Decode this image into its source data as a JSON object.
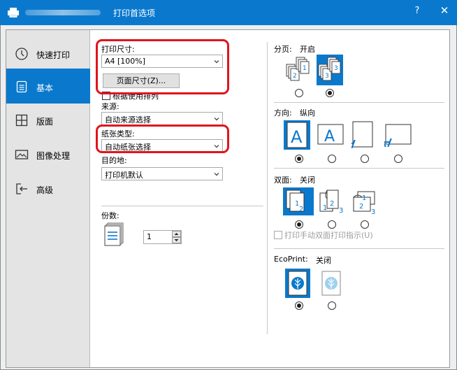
{
  "window": {
    "title": "打印首选项",
    "help_label": "?",
    "close_label": "✕"
  },
  "sidebar": {
    "items": [
      {
        "label": "快速打印",
        "icon": "clock-icon",
        "active": false
      },
      {
        "label": "基本",
        "icon": "document-icon",
        "active": true
      },
      {
        "label": "版面",
        "icon": "layout-grid-icon",
        "active": false
      },
      {
        "label": "图像处理",
        "icon": "image-icon",
        "active": false
      },
      {
        "label": "高级",
        "icon": "advanced-arrow-icon",
        "active": false
      }
    ]
  },
  "basic": {
    "print_size_label": "打印尺寸:",
    "print_size_value": "A4  [100%]",
    "page_size_button": "页面尺寸(Z)...",
    "fit_by_usage_label": "根据使用排列",
    "source_label": "来源:",
    "source_value": "自动来源选择",
    "media_type_label": "纸张类型:",
    "media_type_value": "自动纸张选择",
    "destination_label": "目的地:",
    "destination_value": "打印机默认",
    "copies_label": "份数:",
    "copies_value": "1"
  },
  "right": {
    "collate_label": "分页:",
    "collate_value": "开启",
    "collate_selected": 1,
    "orientation_label": "方向:",
    "orientation_value": "纵向",
    "orientation_selected": 0,
    "duplex_label": "双面:",
    "duplex_value": "关闭",
    "duplex_selected": 0,
    "manual_duplex_label": "打印手动双面打印指示(U)",
    "ecoprint_label": "EcoPrint:",
    "ecoprint_value": "关闭",
    "ecoprint_selected": 0
  },
  "colors": {
    "accent": "#0a79cd",
    "highlight": "#e0141e",
    "sidebar_bg": "#e4e4e4"
  }
}
